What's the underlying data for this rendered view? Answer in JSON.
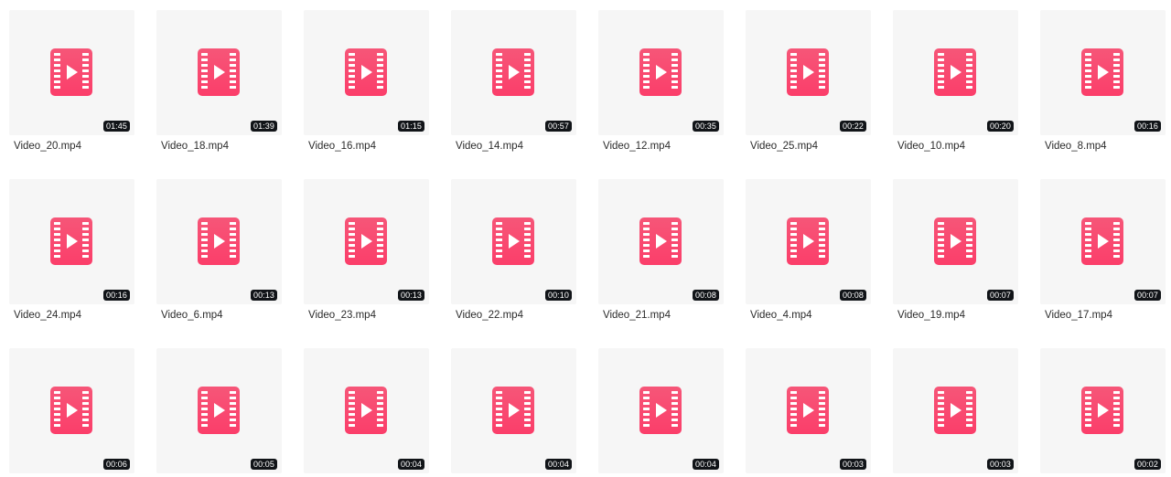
{
  "icons": {
    "tile_icon": "video-file-icon",
    "accent": "#fb4f75"
  },
  "videos": [
    {
      "name": "Video_20.mp4",
      "duration": "01:45"
    },
    {
      "name": "Video_18.mp4",
      "duration": "01:39"
    },
    {
      "name": "Video_16.mp4",
      "duration": "01:15"
    },
    {
      "name": "Video_14.mp4",
      "duration": "00:57"
    },
    {
      "name": "Video_12.mp4",
      "duration": "00:35"
    },
    {
      "name": "Video_25.mp4",
      "duration": "00:22"
    },
    {
      "name": "Video_10.mp4",
      "duration": "00:20"
    },
    {
      "name": "Video_8.mp4",
      "duration": "00:16"
    },
    {
      "name": "Video_24.mp4",
      "duration": "00:16"
    },
    {
      "name": "Video_6.mp4",
      "duration": "00:13"
    },
    {
      "name": "Video_23.mp4",
      "duration": "00:13"
    },
    {
      "name": "Video_22.mp4",
      "duration": "00:10"
    },
    {
      "name": "Video_21.mp4",
      "duration": "00:08"
    },
    {
      "name": "Video_4.mp4",
      "duration": "00:08"
    },
    {
      "name": "Video_19.mp4",
      "duration": "00:07"
    },
    {
      "name": "Video_17.mp4",
      "duration": "00:07"
    },
    {
      "name": "",
      "duration": "00:06"
    },
    {
      "name": "",
      "duration": "00:05"
    },
    {
      "name": "",
      "duration": "00:04"
    },
    {
      "name": "",
      "duration": "00:04"
    },
    {
      "name": "",
      "duration": "00:04"
    },
    {
      "name": "",
      "duration": "00:03"
    },
    {
      "name": "",
      "duration": "00:03"
    },
    {
      "name": "",
      "duration": "00:02"
    }
  ]
}
